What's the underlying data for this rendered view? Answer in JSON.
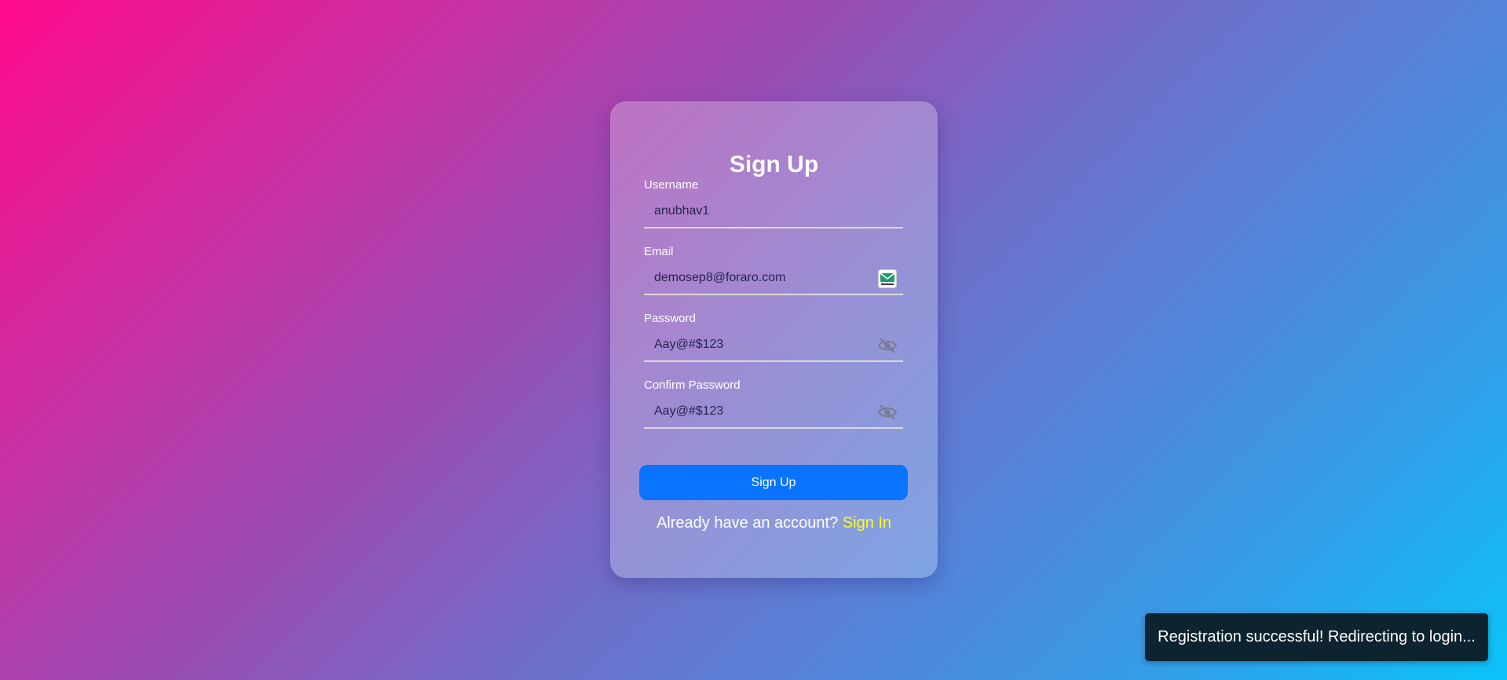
{
  "form": {
    "title": "Sign Up",
    "fields": [
      {
        "label": "Username",
        "value": "anubhav1",
        "icon": ""
      },
      {
        "label": "Email",
        "value": "demosep8@foraro.com",
        "icon": "email-extension-icon"
      },
      {
        "label": "Password",
        "value": "Aay@#$123",
        "icon": "eye-slash-icon"
      },
      {
        "label": "Confirm Password",
        "value": "Aay@#$123",
        "icon": "eye-slash-icon"
      }
    ],
    "submit_label": "Sign Up",
    "signin_prompt": "Already have an account?",
    "signin_link": "Sign In"
  },
  "toast": {
    "message": "Registration successful! Redirecting to login..."
  },
  "colors": {
    "button": "#0a74ff",
    "link": "#ffff1a",
    "toast_bg": "#0d2430"
  }
}
